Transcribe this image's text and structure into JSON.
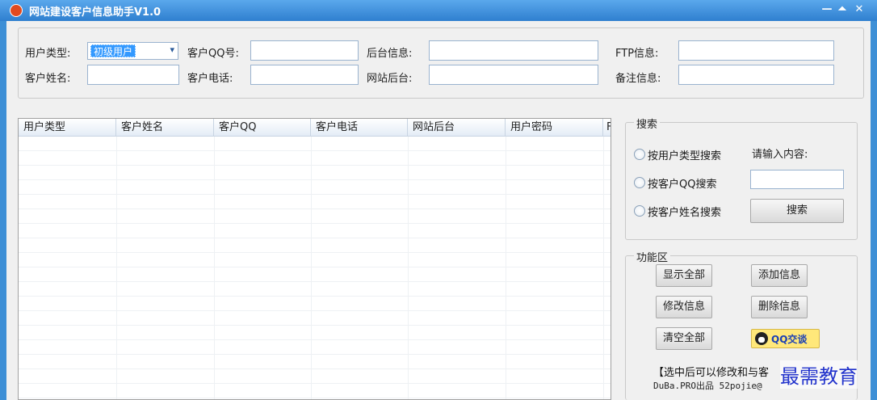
{
  "window": {
    "title": "网站建设客户信息助手V1.0",
    "min_glyph": "—",
    "restore_glyph": "⏶",
    "close_glyph": "✕"
  },
  "form": {
    "user_type_label": "用户类型:",
    "user_type_value": "初级用户",
    "qq_label": "客户QQ号:",
    "qq_value": "",
    "backend_info_label": "后台信息:",
    "backend_info_value": "",
    "ftp_label": "FTP信息:",
    "ftp_value": "",
    "name_label": "客户姓名:",
    "name_value": "",
    "phone_label": "客户电话:",
    "phone_value": "",
    "site_backend_label": "网站后台:",
    "site_backend_value": "",
    "remark_label": "备注信息:",
    "remark_value": ""
  },
  "grid": {
    "columns": [
      "用户类型",
      "客户姓名",
      "客户QQ",
      "客户电话",
      "网站后台",
      "用户密码",
      "F"
    ],
    "rows": []
  },
  "search": {
    "legend": "搜索",
    "options": [
      "按用户类型搜索",
      "按客户QQ搜索",
      "按客户姓名搜索"
    ],
    "prompt": "请输入内容:",
    "input_value": "",
    "button_label": "搜索"
  },
  "functions": {
    "legend": "功能区",
    "show_all": "显示全部",
    "add_info": "添加信息",
    "edit_info": "修改信息",
    "delete_info": "删除信息",
    "clear_all": "清空全部",
    "qq_chat": "QQ交谈",
    "note_line1": "【选中后可以修改和与客",
    "note_line2": "DuBa.PRO出品 52pojie@"
  },
  "watermark": "最需教育",
  "colors": {
    "titlebar": "#2f7fcf",
    "selection": "#3399ff",
    "qq_button": "#ffe87a"
  }
}
